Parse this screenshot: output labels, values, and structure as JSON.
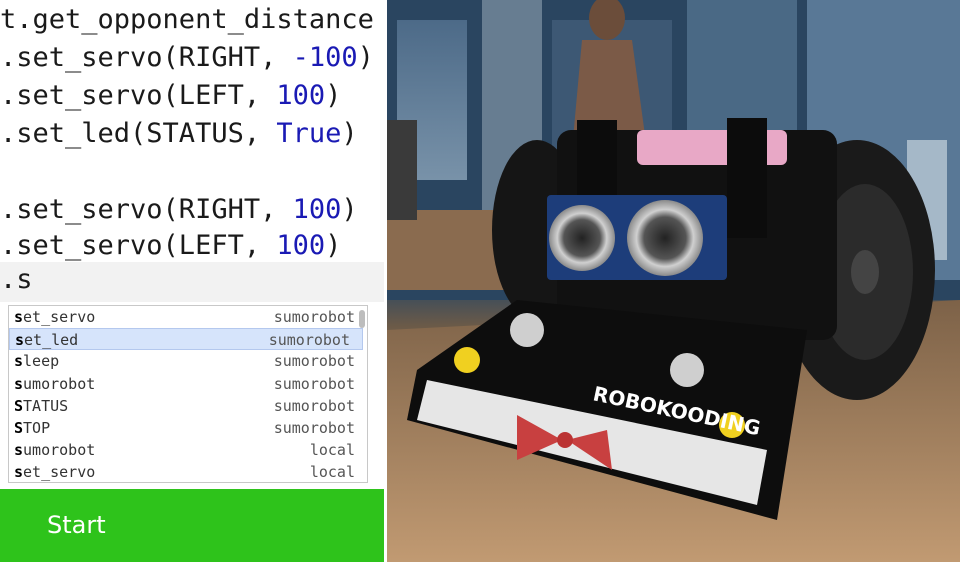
{
  "code_lines": [
    {
      "a": "t.get_opponent_distance",
      "b": "",
      "c": ""
    },
    {
      "a": ".set_servo(RIGHT, ",
      "b": "-100",
      "c": ")"
    },
    {
      "a": ".set_servo(LEFT, ",
      "b": "100",
      "c": ")"
    },
    {
      "a": ".set_led(STATUS, ",
      "b": "True",
      "c": ")"
    },
    {
      "a": "",
      "b": "",
      "c": ""
    },
    {
      "a": ".set_servo(RIGHT, ",
      "b": "100",
      "c": ")"
    },
    {
      "a": ".set_servo(LEFT, ",
      "b": "100",
      "c": ")"
    }
  ],
  "current_line": ".s",
  "autocomplete": {
    "items": [
      {
        "prefix": "s",
        "rest": "et_servo",
        "source": "sumorobot"
      },
      {
        "prefix": "s",
        "rest": "et_led",
        "source": "sumorobot"
      },
      {
        "prefix": "s",
        "rest": "leep",
        "source": "sumorobot"
      },
      {
        "prefix": "s",
        "rest": "umorobot",
        "source": "sumorobot"
      },
      {
        "prefix": "S",
        "rest": "TATUS",
        "source": "sumorobot"
      },
      {
        "prefix": "S",
        "rest": "TOP",
        "source": "sumorobot"
      },
      {
        "prefix": "s",
        "rest": "umorobot",
        "source": "local"
      },
      {
        "prefix": "s",
        "rest": "et_servo",
        "source": "local"
      }
    ],
    "selected_index": 1
  },
  "start_button": {
    "label": "Start"
  },
  "photo": {
    "board_text": "ROBOKOODING"
  },
  "colors": {
    "start_green": "#2ec31b",
    "number_blue": "#1a1ab4",
    "selection": "#d6e4fb"
  }
}
